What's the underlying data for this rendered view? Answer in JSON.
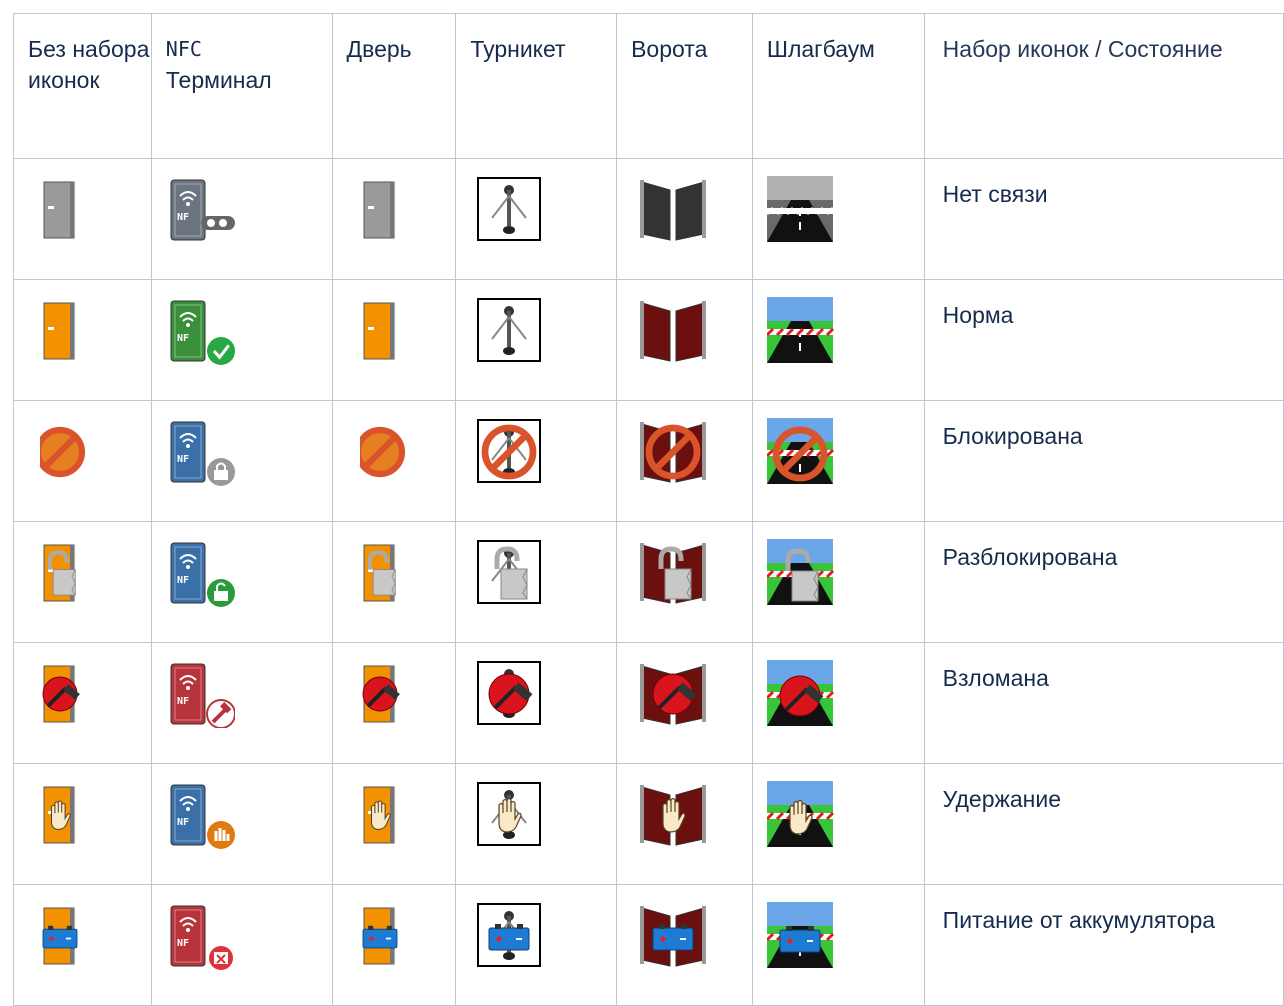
{
  "headers": {
    "col_none": "Без набора иконок",
    "col_nfc_1": "NFC",
    "col_nfc_2": "Терминал",
    "col_door": "Дверь",
    "col_turnstile": "Турникет",
    "col_gate": "Ворота",
    "col_barrier": "Шлагбаум",
    "col_state": "Набор иконок / Состояние"
  },
  "rows": [
    {
      "state": "Нет связи",
      "icon_state": "no-connection"
    },
    {
      "state": "Норма",
      "icon_state": "normal"
    },
    {
      "state": "Блокирована",
      "icon_state": "blocked"
    },
    {
      "state": "Разблокирована",
      "icon_state": "unblocked"
    },
    {
      "state": "Взломана",
      "icon_state": "broken"
    },
    {
      "state": "Удержание",
      "icon_state": "hold"
    },
    {
      "state": "Питание от аккумулятора",
      "icon_state": "battery"
    }
  ],
  "icon_sets": [
    "none",
    "nfc-terminal",
    "door",
    "turnstile",
    "gate",
    "barrier"
  ],
  "colors": {
    "grid": "#c1c7d0",
    "door_gray": "#9a9a9a",
    "door_orange": "#f39200",
    "nfc_gray": "#6b7480",
    "nfc_green": "#3a8f3a",
    "nfc_blue": "#3b6fa8",
    "nfc_red": "#b8343c",
    "nfc_orange": "#c4702a",
    "forbidden": "#d9532b",
    "check": "#27a844",
    "hammer_disk": "#d9141c",
    "battery": "#1e7bd3"
  }
}
